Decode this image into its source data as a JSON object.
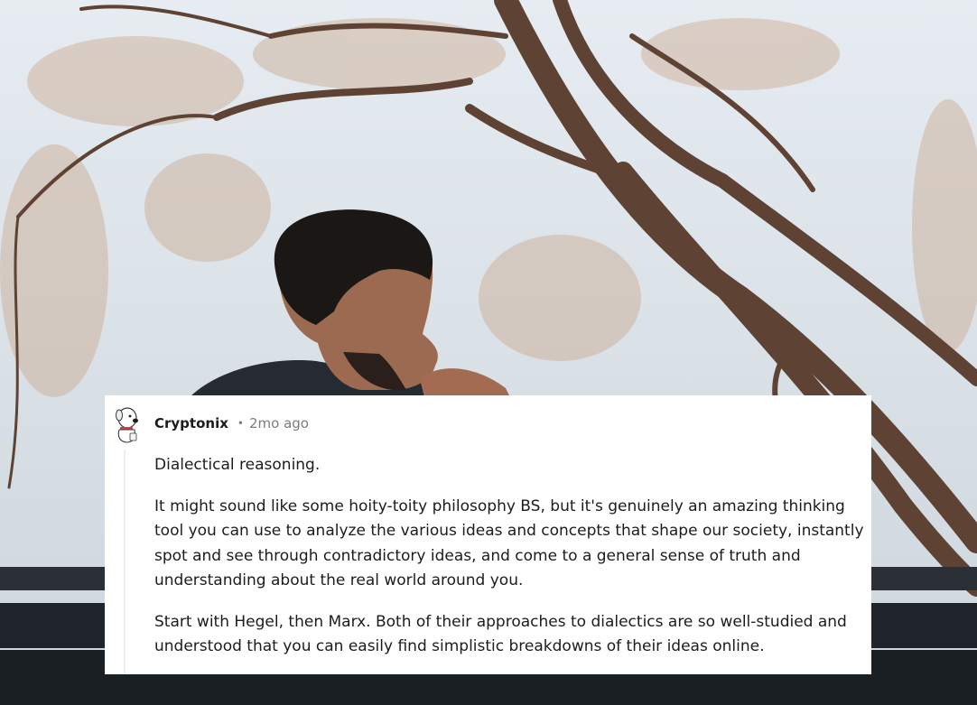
{
  "comment": {
    "username": "Cryptonix",
    "separator": "•",
    "timestamp": "2mo ago",
    "avatar_icon": "snoo-dog-avatar-icon",
    "paragraphs": [
      "Dialectical reasoning.",
      "It might sound like some hoity-toity philosophy BS, but it's genuinely an amazing thinking tool you can use to analyze the various ideas and concepts that shape our society, instantly spot and see through contradictory ideas, and come to a general sense of truth and understanding about the real world around you.",
      "Start with Hegel, then Marx. Both of their approaches to dialectics are so well-studied and understood that you can easily find simplistic breakdowns of their ideas online."
    ]
  },
  "colors": {
    "sky": "#dfe6ec",
    "branches": "#6b4a3a",
    "card_bg": "#ffffff",
    "text": "#1c1c1c",
    "meta": "#7c7c7c",
    "thread_line": "#edeff1"
  }
}
